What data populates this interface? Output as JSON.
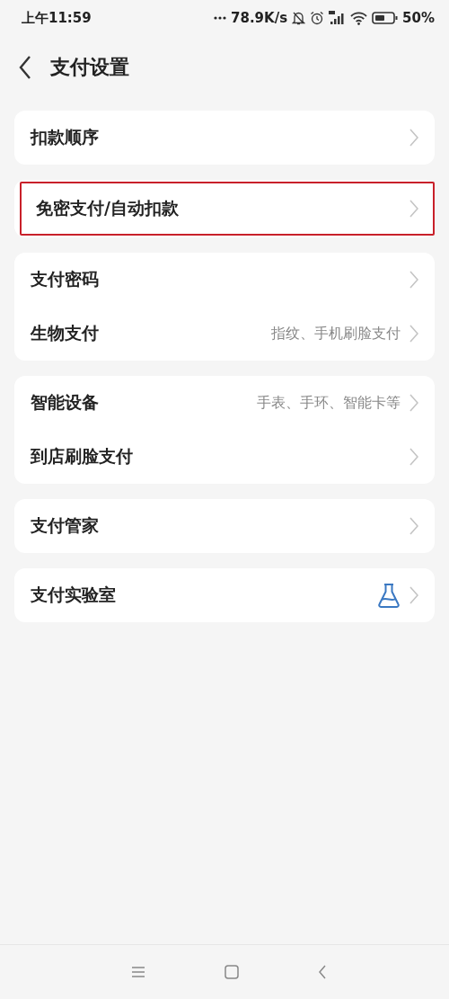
{
  "status_bar": {
    "time": "上午11:59",
    "network_speed": "78.9K/s",
    "battery": "50%"
  },
  "header": {
    "title": "支付设置"
  },
  "groups": [
    {
      "items": [
        {
          "label": "扣款顺序",
          "kind": "plain",
          "highlighted": false
        }
      ]
    },
    {
      "items": [
        {
          "label": "免密支付/自动扣款",
          "kind": "plain",
          "highlighted": true
        }
      ]
    },
    {
      "items": [
        {
          "label": "支付密码",
          "kind": "plain",
          "highlighted": false
        },
        {
          "label": "生物支付",
          "kind": "detail",
          "detail": "指纹、手机刷脸支付",
          "highlighted": false
        }
      ]
    },
    {
      "items": [
        {
          "label": "智能设备",
          "kind": "detail",
          "detail": "手表、手环、智能卡等",
          "highlighted": false
        },
        {
          "label": "到店刷脸支付",
          "kind": "plain",
          "highlighted": false
        }
      ]
    },
    {
      "items": [
        {
          "label": "支付管家",
          "kind": "plain",
          "highlighted": false
        }
      ]
    },
    {
      "items": [
        {
          "label": "支付实验室",
          "kind": "icon",
          "highlighted": false
        }
      ]
    }
  ]
}
